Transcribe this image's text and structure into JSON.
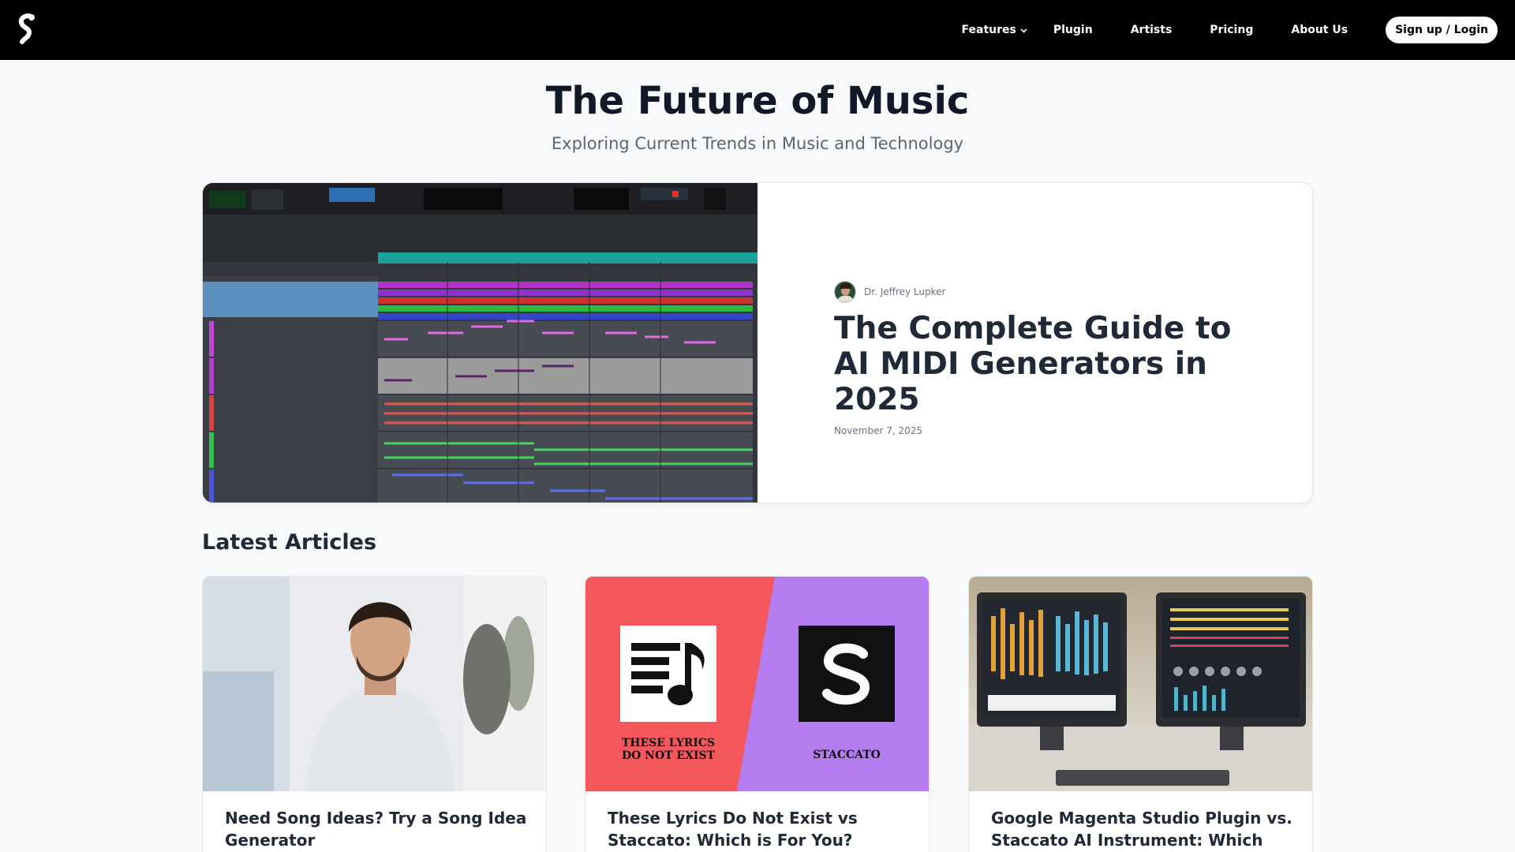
{
  "nav": {
    "links": [
      {
        "label": "Features"
      },
      {
        "label": "Plugin"
      },
      {
        "label": "Artists"
      },
      {
        "label": "Pricing"
      },
      {
        "label": "About Us"
      }
    ],
    "cta": "Sign up / Login"
  },
  "hero": {
    "title": "The Future of Music",
    "subtitle": "Exploring Current Trends in Music and Technology"
  },
  "featured": {
    "author": "Dr. Jeffrey Lupker",
    "title": "The Complete Guide to AI MIDI Generators in 2025",
    "date": "November 7, 2025"
  },
  "latest": {
    "heading": "Latest Articles",
    "cards": [
      {
        "title": "Need Song Ideas? Try a Song Idea Generator"
      },
      {
        "title": "These Lyrics Do Not Exist vs Staccato: Which is For You?",
        "left_caption_1": "THESE LYRICS",
        "left_caption_2": "DO NOT EXIST",
        "right_caption": "STACCATO"
      },
      {
        "title": "Google Magenta Studio Plugin vs. Staccato AI Instrument: Which One"
      }
    ]
  },
  "colors": {
    "nav_bg": "#000000",
    "page_bg": "#f8f9fb",
    "card2_left": "#f5585c",
    "card2_right": "#b57cf0"
  }
}
